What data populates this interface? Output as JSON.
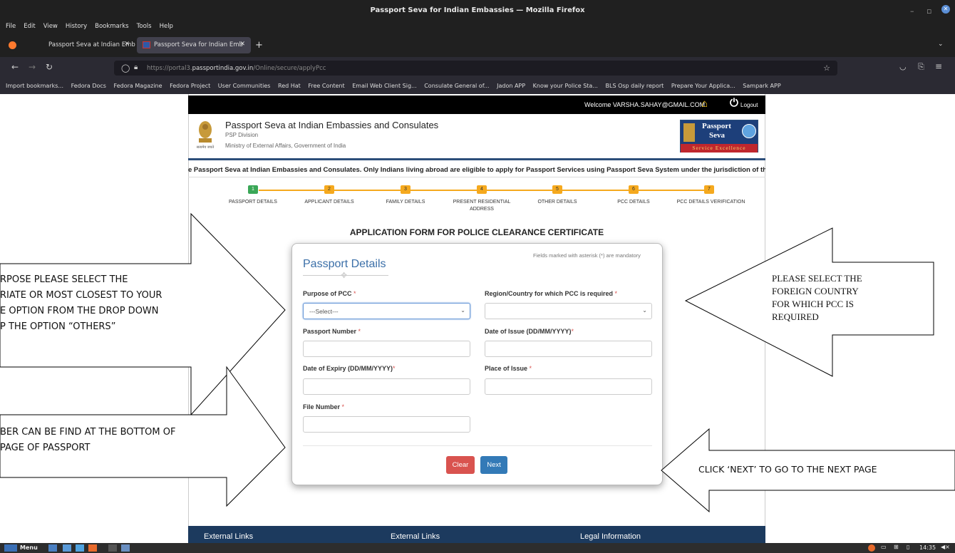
{
  "browser": {
    "window_title": "Passport Seva for Indian Embassies — Mozilla Firefox",
    "menu": [
      "File",
      "Edit",
      "View",
      "History",
      "Bookmarks",
      "Tools",
      "Help"
    ],
    "tabs": [
      {
        "label": "Passport Seva at Indian Embassie"
      },
      {
        "label": "Passport Seva for Indian Emb"
      }
    ],
    "new_tab": "+",
    "url_prefix": "https://portal3.",
    "url_domain": "passportindia.gov.in",
    "url_path": "/Online/secure/applyPcc",
    "bookmarks": [
      "Import bookmarks...",
      "Fedora Docs",
      "Fedora Magazine",
      "Fedora Project",
      "User Communities",
      "Red Hat",
      "Free Content",
      "Email Web Client Sig...",
      "Consulate General of...",
      "Jadon APP",
      "Know your Police Sta...",
      "BLS Osp daily report",
      "Prepare Your Applica...",
      "Sampark APP"
    ]
  },
  "site": {
    "welcome": "Welcome VARSHA.SAHAY@GMAIL.COM",
    "logout": "Logout",
    "title": "Passport Seva at Indian Embassies and Consulates",
    "division": "PSP Division",
    "ministry": "Ministry of External Affairs, Government of India",
    "logo_line1": "Passport",
    "logo_line2": "Seva",
    "logo_tagline": "Service Excellence",
    "marquee": "e Passport Seva at Indian Embassies and Consulates. Only Indians living abroad are eligible to apply for Passport Services using Passport Seva System under the jurisdiction of the respect",
    "steps": [
      {
        "num": "1",
        "label": "PASSPORT DETAILS",
        "active": true
      },
      {
        "num": "2",
        "label": "APPLICANT DETAILS"
      },
      {
        "num": "3",
        "label": "FAMILY DETAILS"
      },
      {
        "num": "4",
        "label": "PRESENT RESIDENTIAL ADDRESS"
      },
      {
        "num": "5",
        "label": "OTHER DETAILS"
      },
      {
        "num": "6",
        "label": "PCC DETAILS"
      },
      {
        "num": "7",
        "label": "PCC DETAILS VERIFICATION"
      }
    ],
    "form_title": "APPLICATION FORM FOR POLICE CLEARANCE CERTIFICATE",
    "footer": [
      "External Links",
      "External Links",
      "Legal Information"
    ]
  },
  "form": {
    "heading": "Passport Details",
    "mandatory_note": "Fields marked with asterisk (*) are mandatory",
    "fields": {
      "purpose": {
        "label": "Purpose of PCC",
        "value": "---Select---"
      },
      "region": {
        "label": "Region/Country for which PCC is required",
        "value": ""
      },
      "passport_number": {
        "label": "Passport Number"
      },
      "date_of_issue": {
        "label": "Date of Issue (DD/MM/YYYY)"
      },
      "date_of_expiry": {
        "label": "Date of Expiry (DD/MM/YYYY)"
      },
      "place_of_issue": {
        "label": "Place of Issue"
      },
      "file_number": {
        "label": "File Number"
      }
    },
    "clear_label": "Clear",
    "next_label": "Next"
  },
  "annotations": {
    "purpose_lines": [
      "RPOSE PLEASE SELECT THE",
      "RIATE OR MOST CLOSEST TO YOUR",
      "E OPTION FROM THE DROP DOWN",
      "P THE OPTION “OTHERS”"
    ],
    "file_lines": [
      "BER CAN BE FIND AT THE BOTTOM OF",
      "PAGE OF PASSPORT"
    ],
    "country_lines": [
      "PLEASE SELECT THE",
      "FOREIGN COUNTRY",
      "FOR WHICH PCC IS",
      "REQUIRED"
    ],
    "next_text": "CLICK ‘NEXT’ TO GO TO THE NEXT PAGE"
  },
  "taskbar": {
    "menu": "Menu",
    "clock": "14:35"
  }
}
